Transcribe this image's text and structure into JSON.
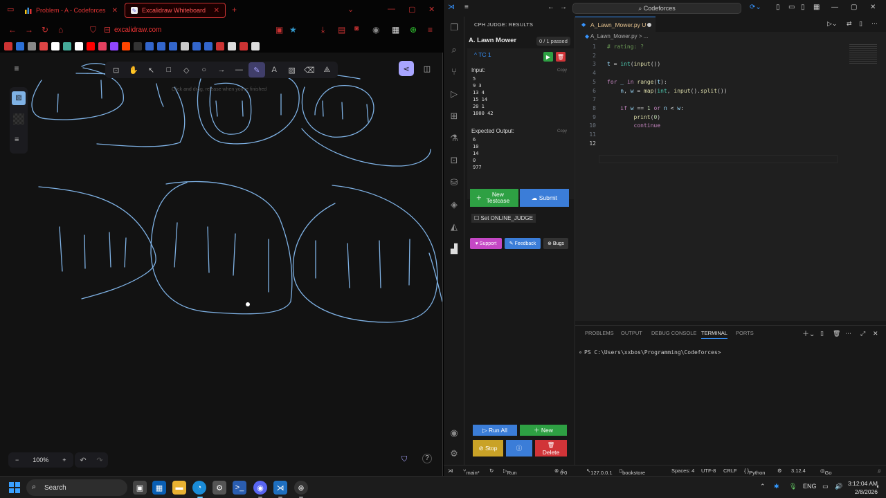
{
  "browser": {
    "tabs": [
      {
        "label": "Problem - A - Codeforces",
        "icon": "codeforces-icon"
      },
      {
        "label": "Excalidraw Whiteboard",
        "icon": "excalidraw-icon"
      }
    ],
    "url": "excalidraw.com",
    "bookmark_badge": "10"
  },
  "excalidraw": {
    "hint": "Click and drag, release when you're finished",
    "zoom": "100%",
    "tools": [
      "lock-icon",
      "hand-icon",
      "selection-icon",
      "rectangle-icon",
      "diamond-icon",
      "ellipse-icon",
      "arrow-icon",
      "line-icon",
      "pencil-icon",
      "text-icon",
      "image-icon",
      "eraser-icon",
      "shapes-icon"
    ],
    "active_tool": "pencil-icon",
    "stroke_color": "#7fb2e5"
  },
  "vscode": {
    "search": "Codeforces",
    "cph": {
      "title": "CPH JUDGE: RESULTS",
      "problem": "A. Lawn Mower",
      "passed": "0 / 1 passed",
      "tc_label": "TC 1",
      "input_label": "Input:",
      "input": "5\n9 3\n13 4\n15 14\n20 1\n1000 42",
      "expected_label": "Expected Output:",
      "expected": "6\n10\n14\n0\n977",
      "copy": "Copy",
      "new_testcase": "New Testcase",
      "submit": "Submit",
      "online_judge": "Set ONLINE_JUDGE",
      "support": "Support",
      "feedback": "Feedback",
      "bugs": "Bugs",
      "run_all": "Run All",
      "new": "New",
      "stop": "Stop",
      "delete": "Delete"
    },
    "editor": {
      "tab": "A_Lawn_Mower.py",
      "tab_status": "U",
      "breadcrumb": "A_Lawn_Mower.py >",
      "line_numbers": [
        "1",
        "2",
        "3",
        "4",
        "5",
        "6",
        "7",
        "8",
        "9",
        "10",
        "11",
        "12"
      ]
    },
    "panel": {
      "tabs": [
        "PROBLEMS",
        "OUTPUT",
        "DEBUG CONSOLE",
        "TERMINAL",
        "PORTS"
      ],
      "active": "TERMINAL",
      "prompt": "PS C:\\Users\\xxbos\\Programming\\Codeforces>"
    },
    "status": {
      "branch": "main*",
      "run_testcases": "Run Testcases",
      "errors": "0",
      "warnings": "0",
      "host": "127.0.0.1",
      "bookstore": "bookstore",
      "spaces": "Spaces: 4",
      "encoding": "UTF-8",
      "eol": "CRLF",
      "language": "Python",
      "version": "3.12.4",
      "golive": "Go Live"
    }
  },
  "taskbar": {
    "search": "Search",
    "lang": "ENG",
    "time": "3:12:04 AM",
    "date": "2/8/2026"
  }
}
